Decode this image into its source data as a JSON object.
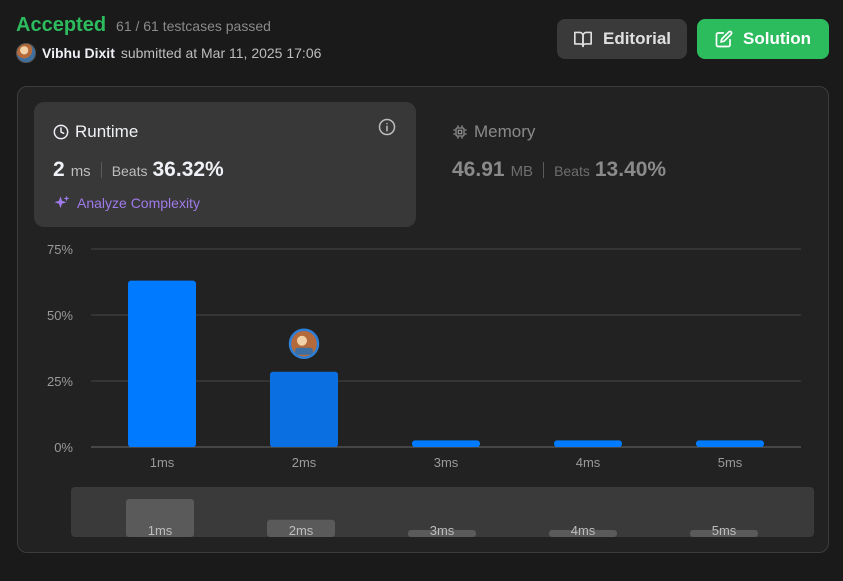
{
  "header": {
    "status": "Accepted",
    "testcases": "61 / 61 testcases passed",
    "user_name": "Vibhu Dixit",
    "submitted_text": "submitted at Mar 11, 2025 17:06",
    "editorial_label": "Editorial",
    "solution_label": "Solution"
  },
  "runtime": {
    "title": "Runtime",
    "value": "2",
    "unit": "ms",
    "beats_label": "Beats",
    "beats_value": "36.32%",
    "analyze_label": "Analyze Complexity"
  },
  "memory": {
    "title": "Memory",
    "value": "46.91",
    "unit": "MB",
    "beats_label": "Beats",
    "beats_value": "13.40%"
  },
  "colors": {
    "accent_green": "#2cbb5d",
    "bar_blue": "#007aff",
    "bar_selected": "#0a6fe0",
    "analyze_purple": "#9f7aea"
  },
  "chart_data": {
    "type": "bar",
    "categories": [
      "1ms",
      "2ms",
      "3ms",
      "4ms",
      "5ms"
    ],
    "values": [
      63,
      28.5,
      2.5,
      2.5,
      2.5
    ],
    "ylim": [
      0,
      75
    ],
    "yticks": [
      "0%",
      "25%",
      "50%",
      "75%"
    ],
    "ytick_values": [
      0,
      25,
      50,
      75
    ],
    "selected_category": "2ms",
    "grid": true
  },
  "mini_chart": {
    "categories": [
      "1ms",
      "2ms",
      "3ms",
      "4ms",
      "5ms"
    ],
    "values": [
      63,
      28.5,
      2.5,
      2.5,
      2.5
    ]
  }
}
